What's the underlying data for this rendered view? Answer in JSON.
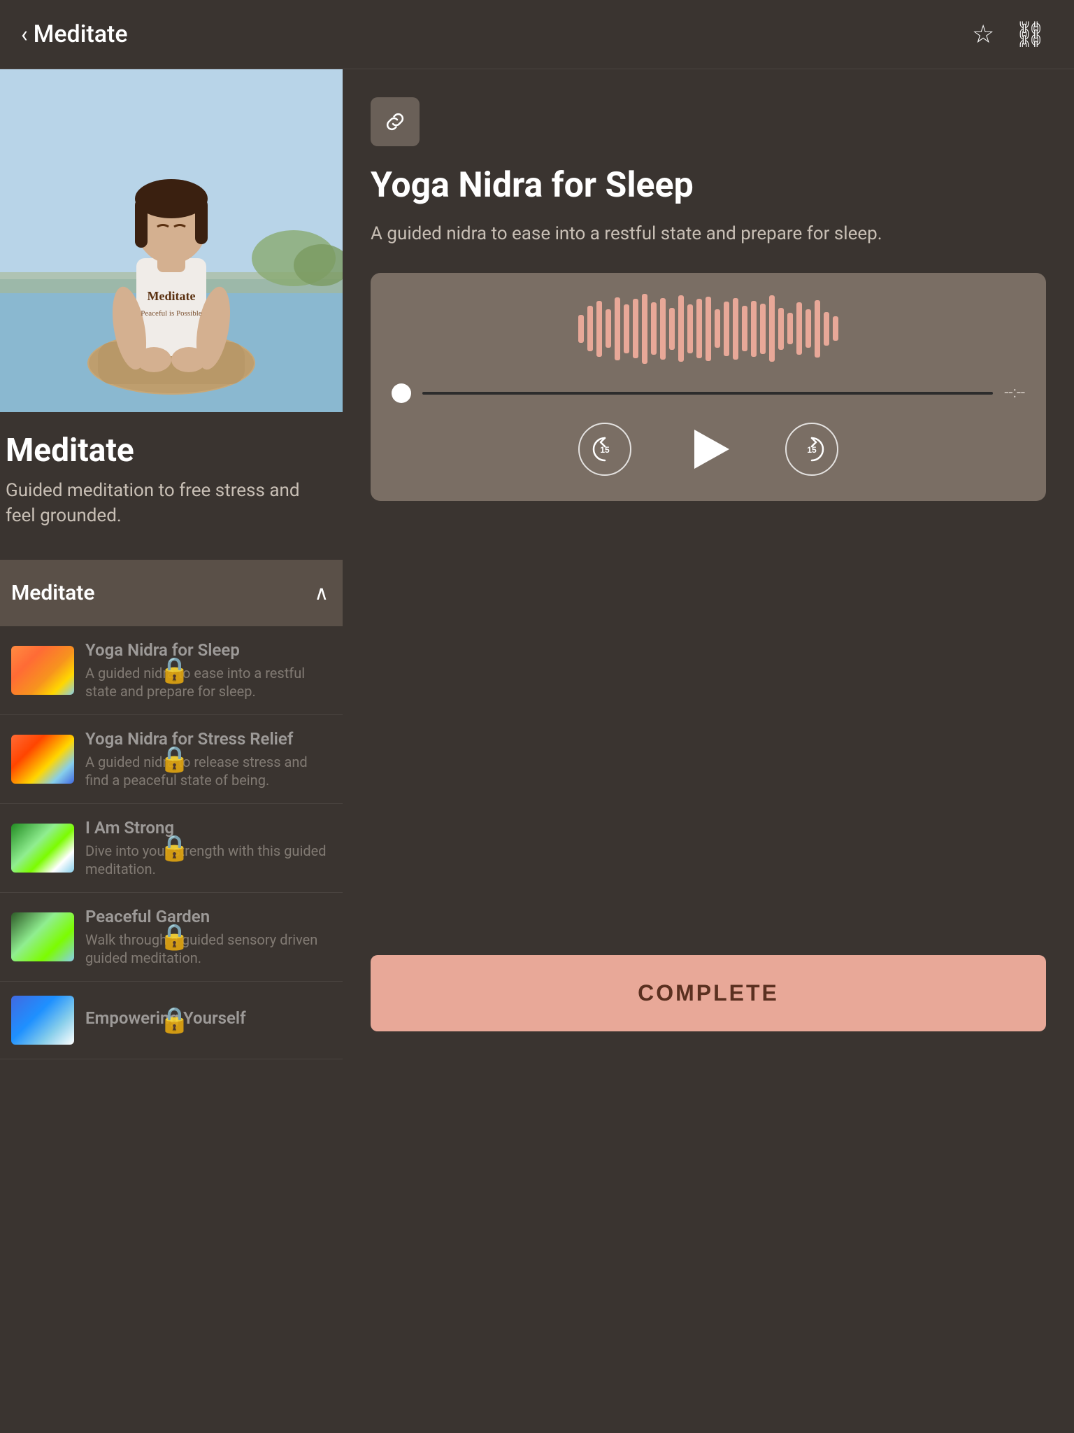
{
  "header": {
    "back_label": "Meditate",
    "back_icon": "‹",
    "bookmark_icon": "☆",
    "link_icon": "⛓"
  },
  "left_panel": {
    "program_title": "Meditate",
    "program_desc": "Guided meditation to free stress and feel grounded.",
    "accordion": {
      "title": "Meditate",
      "chevron": "∧",
      "items": [
        {
          "name": "Yoga Nidra for Sleep",
          "desc": "A guided nidra to ease into a restful state and prepare for sleep.",
          "locked": true,
          "thumb_class": "thumb-sleep"
        },
        {
          "name": "Yoga Nidra for Stress Relief",
          "desc": "A guided nidra to release stress and find a peaceful state of being.",
          "locked": true,
          "thumb_class": "thumb-stress"
        },
        {
          "name": "I Am Strong",
          "desc": "Dive into your strength with this guided meditation.",
          "locked": true,
          "thumb_class": "thumb-strong"
        },
        {
          "name": "Peaceful Garden",
          "desc": "Walk through a guided sensory driven guided meditation.",
          "locked": true,
          "thumb_class": "thumb-garden"
        },
        {
          "name": "Empowering Yourself",
          "desc": "",
          "locked": true,
          "thumb_class": "thumb-empowering"
        }
      ]
    }
  },
  "right_panel": {
    "link_icon": "⛓",
    "content_title": "Yoga Nidra for Sleep",
    "content_desc": "A guided nidra to ease into a restful state and prepare for sleep.",
    "audio_player": {
      "progress_time": "--:--",
      "rewind_label": "15",
      "forward_label": "15"
    },
    "complete_button_label": "COMPLETE"
  }
}
